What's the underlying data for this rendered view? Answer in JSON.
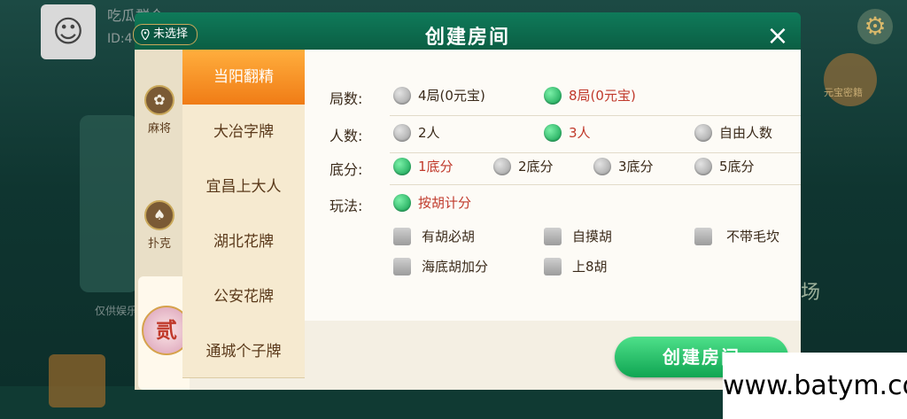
{
  "background": {
    "user_name": "吃瓜群众",
    "user_id": "ID:4",
    "right_label": "元宝密籍",
    "field_text": "场",
    "left_text": "仅供娱乐"
  },
  "header": {
    "title": "创建房间",
    "location": "未选择",
    "close": "×"
  },
  "categories": [
    {
      "label": "麻将",
      "icon": "✿"
    },
    {
      "label": "扑克",
      "icon": "♠"
    }
  ],
  "coin_label": "贰",
  "games": [
    {
      "label": "当阳翻精",
      "active": true
    },
    {
      "label": "大冶字牌"
    },
    {
      "label": "宜昌上大人"
    },
    {
      "label": "湖北花牌"
    },
    {
      "label": "公安花牌"
    },
    {
      "label": "通城个子牌"
    }
  ],
  "rows": {
    "rounds": {
      "label": "局数:",
      "options": [
        "4局(0元宝)",
        "8局(0元宝)"
      ],
      "selected": 1
    },
    "players": {
      "label": "人数:",
      "options": [
        "2人",
        "3人",
        "自由人数"
      ],
      "selected": 1
    },
    "base": {
      "label": "底分:",
      "options": [
        "1底分",
        "2底分",
        "3底分",
        "5底分"
      ],
      "selected": 0
    },
    "rules": {
      "label": "玩法:",
      "options": [
        "按胡计分"
      ],
      "selected": 0,
      "checks": [
        "有胡必胡",
        "自摸胡",
        "不带毛坎",
        "海底胡加分",
        "上8胡"
      ]
    }
  },
  "create_button": "创建房间",
  "watermark": "www.batym.com"
}
